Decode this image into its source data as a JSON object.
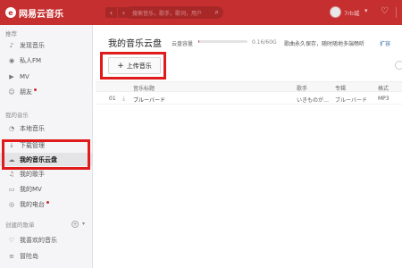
{
  "app": {
    "logo_mark": "e",
    "logo_text": "网易云音乐"
  },
  "topbar": {
    "back_icon": "chevron-left-icon",
    "forward_icon": "chevron-right-icon",
    "search_placeholder": "搜索音乐，歌手，歌词，用户",
    "username": "7rb城",
    "colors": {
      "brand": "#c62f2f"
    }
  },
  "sidebar": {
    "recommend_title": "推荐",
    "recommend_items": [
      {
        "label": "发现音乐",
        "icon": "music-note-icon"
      },
      {
        "label": "私人FM",
        "icon": "radio-icon"
      },
      {
        "label": "MV",
        "icon": "video-icon"
      },
      {
        "label": "朋友",
        "icon": "friends-icon"
      }
    ],
    "my_music_title": "我的音乐",
    "my_music_items": [
      {
        "label": "本地音乐",
        "icon": "local-music-icon"
      },
      {
        "label": "下载管理",
        "icon": "download-icon"
      },
      {
        "label": "我的音乐云盘",
        "icon": "cloud-icon"
      },
      {
        "label": "我的歌手",
        "icon": "singer-icon"
      },
      {
        "label": "我的MV",
        "icon": "mv-icon"
      },
      {
        "label": "我的电台",
        "icon": "station-icon"
      }
    ],
    "created_title": "创建的歌单",
    "created_items": [
      {
        "label": "我喜欢的音乐",
        "icon": "heart-icon"
      },
      {
        "label": "冒险岛",
        "icon": "playlist-icon"
      }
    ]
  },
  "main": {
    "title": "我的音乐云盘",
    "capacity_label": "云盘容量",
    "capacity_fraction": 0.002,
    "capacity_value": "0.16/60G",
    "promo_text": "歌曲永久保存，随时随地多端畅听",
    "expand_link": "扩容",
    "upload_button": "上传音乐",
    "table": {
      "headers": [
        "音乐标题",
        "歌手",
        "专辑",
        "格式"
      ],
      "rows": [
        {
          "index": "01",
          "title": "ブルーバード",
          "artist": "いきものが…",
          "album": "ブルーバード",
          "format": "MP3"
        }
      ]
    }
  }
}
